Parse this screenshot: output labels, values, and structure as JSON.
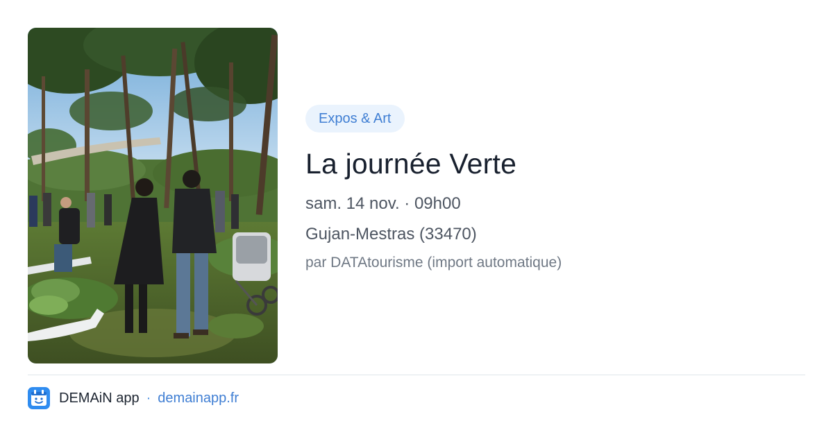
{
  "event": {
    "category": "Expos & Art",
    "title": "La journée Verte",
    "datetime": "sam. 14 nov. · 09h00",
    "location": "Gujan-Mestras (33470)",
    "author": "par DATAtourisme (import automatique)"
  },
  "image": {
    "description": "outdoor-garden-event-photo"
  },
  "footer": {
    "app_name": "DEMAiN app",
    "separator": "·",
    "domain": "demainapp.fr",
    "icon": "demain-app-icon"
  }
}
